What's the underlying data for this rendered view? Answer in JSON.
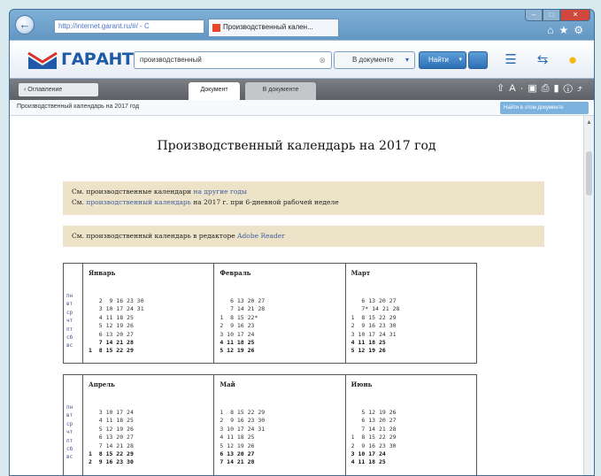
{
  "browser": {
    "address": "http://internet.garant.ru/#/ - C",
    "address_visible": "garant.ru",
    "tab_title": "Производственный кален..."
  },
  "toolbar": {
    "logo_text": "ГАРАНТ",
    "search_value": "производственный",
    "scope_label": "В документе",
    "find_label": "Найти"
  },
  "doc_tabs": {
    "back_label": "‹ Оглавление",
    "doc_label": "Документ",
    "inside_label": "В документе"
  },
  "breadcrumb": {
    "text": "Производственный календарь на 2017 год",
    "right_button": "Найти в этом документе"
  },
  "document": {
    "title": "Производственный календарь на 2017 год",
    "note1_prefix": "См. производственные календари ",
    "note1_link": "на другие годы",
    "note2_prefix": "См. ",
    "note2_link": "производственный календарь",
    "note2_suffix": " на 2017 г. при 6-дневной рабочей неделе",
    "note3_prefix": "См. производственный календарь в редакторе ",
    "note3_link": "Adobe Reader"
  },
  "calendar": {
    "weekdays": [
      "пн",
      "вт",
      "ср",
      "чт",
      "пт",
      "сб",
      "вс"
    ],
    "row1": [
      {
        "name": "Январь",
        "weeks": [
          "   2  9 16 23 30",
          "   3 10 17 24 31",
          "   4 11 18 25",
          "   5 12 19 26",
          "   6 13 20 27",
          "   7 14 21 28",
          "1  8 15 22 29"
        ]
      },
      {
        "name": "Февраль",
        "weeks": [
          "   6 13 20 27",
          "   7 14 21 28",
          "1  8 15 22*",
          "2  9 16 23",
          "3 10 17 24",
          "4 11 18 25",
          "5 12 19 26"
        ]
      },
      {
        "name": "Март",
        "weeks": [
          "   6 13 20 27",
          "   7* 14 21 28",
          "1  8 15 22 29",
          "2  9 16 23 30",
          "3 10 17 24 31",
          "4 11 18 25",
          "5 12 19 26"
        ]
      }
    ],
    "row2": [
      {
        "name": "Апрель",
        "weeks": [
          "   3 10 17 24",
          "   4 11 18 25",
          "   5 12 19 26",
          "   6 13 20 27",
          "   7 14 21 28",
          "1  8 15 22 29",
          "2  9 16 23 30"
        ]
      },
      {
        "name": "Май",
        "weeks": [
          "1  8 15 22 29",
          "2  9 16 23 30",
          "3 10 17 24 31",
          "4 11 18 25",
          "5 12 19 26",
          "6 13 20 27",
          "7 14 21 28"
        ]
      },
      {
        "name": "Июнь",
        "weeks": [
          "   5 12 19 26",
          "   6 13 20 27",
          "   7 14 21 28",
          "1  8 15 22 29",
          "2  9 16 23 30",
          "3 10 17 24",
          "4 11 18 25"
        ]
      }
    ]
  },
  "colors": {
    "note_bg": "#ede3c8",
    "link": "#3b5fa0",
    "brand_blue": "#1f5aa6",
    "brand_red": "#d8332a"
  }
}
